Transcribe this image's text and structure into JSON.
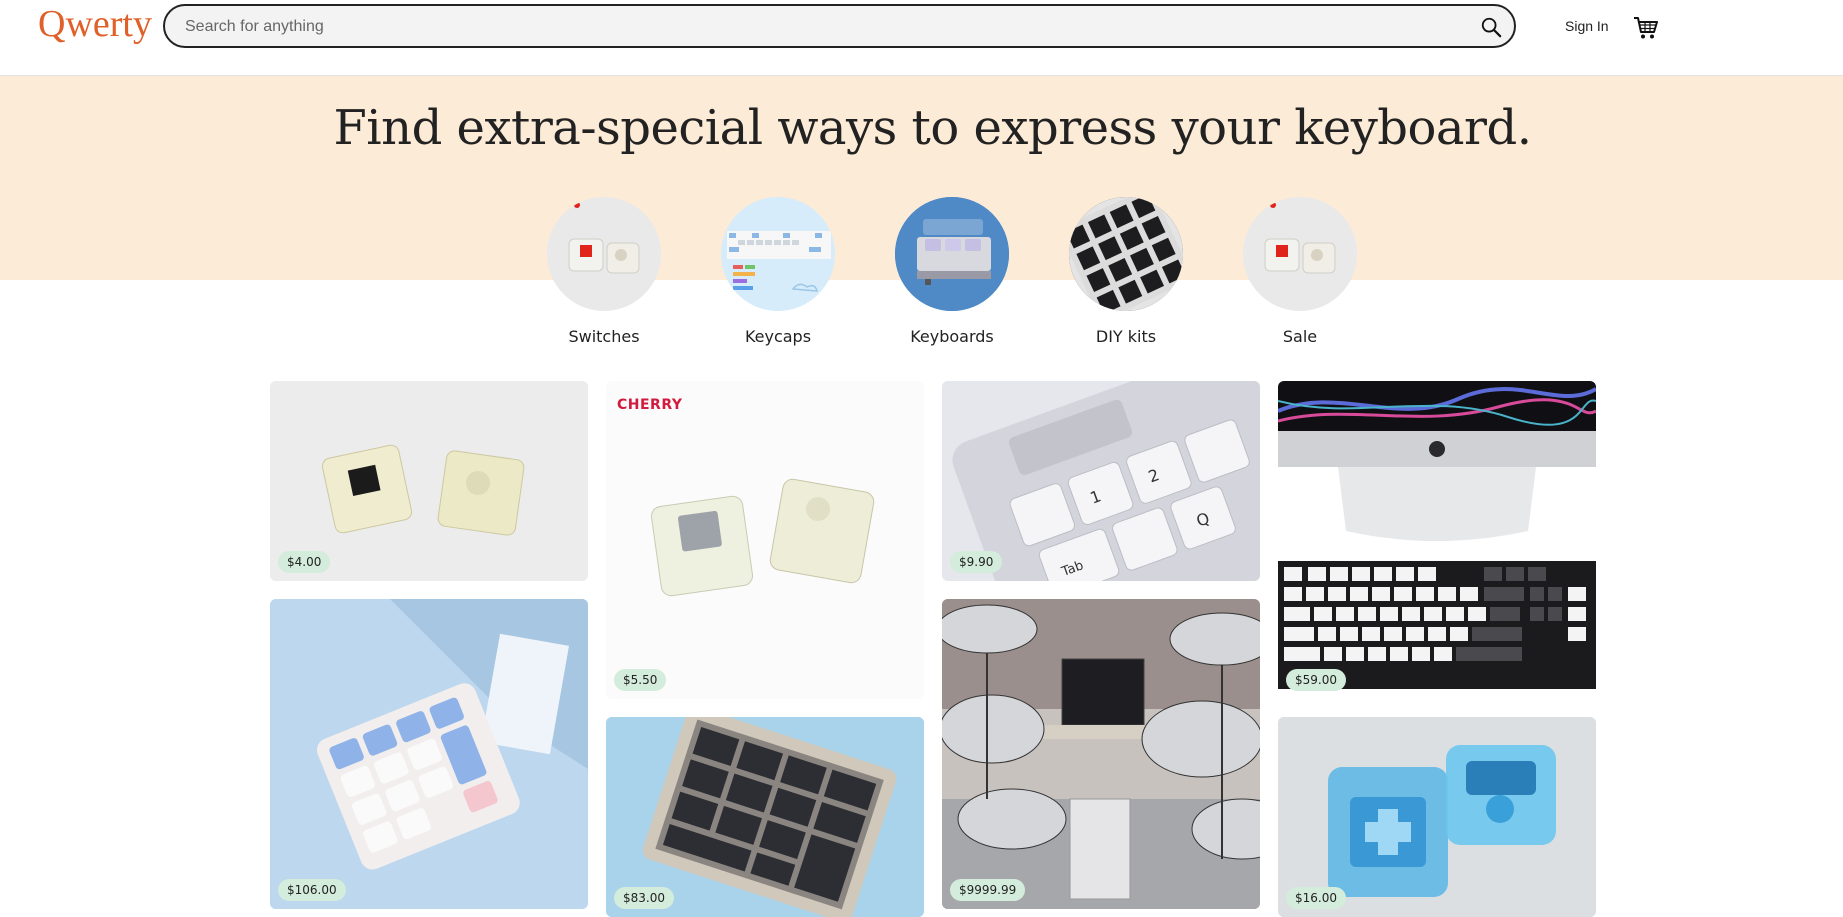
{
  "header": {
    "logo": "Qwerty",
    "search_placeholder": "Search for anything",
    "signin": "Sign In"
  },
  "banner": {
    "headline": "Find extra-special ways to express your keyboard."
  },
  "categories": [
    {
      "label": "Switches"
    },
    {
      "label": "Keycaps"
    },
    {
      "label": "Keyboards"
    },
    {
      "label": "DIY kits"
    },
    {
      "label": "Sale"
    }
  ],
  "products": [
    {
      "price": "$4.00"
    },
    {
      "price": "$5.50",
      "brand": "CHERRY"
    },
    {
      "price": "$9.90"
    },
    {
      "price": "$59.00"
    },
    {
      "price": "$106.00"
    },
    {
      "price": "$83.00"
    },
    {
      "price": "$9999.99"
    },
    {
      "price": "$16.00"
    }
  ],
  "colors": {
    "logo": "#e0602a",
    "banner": "#fbebd7",
    "price_badge": "#d3ecdc"
  }
}
